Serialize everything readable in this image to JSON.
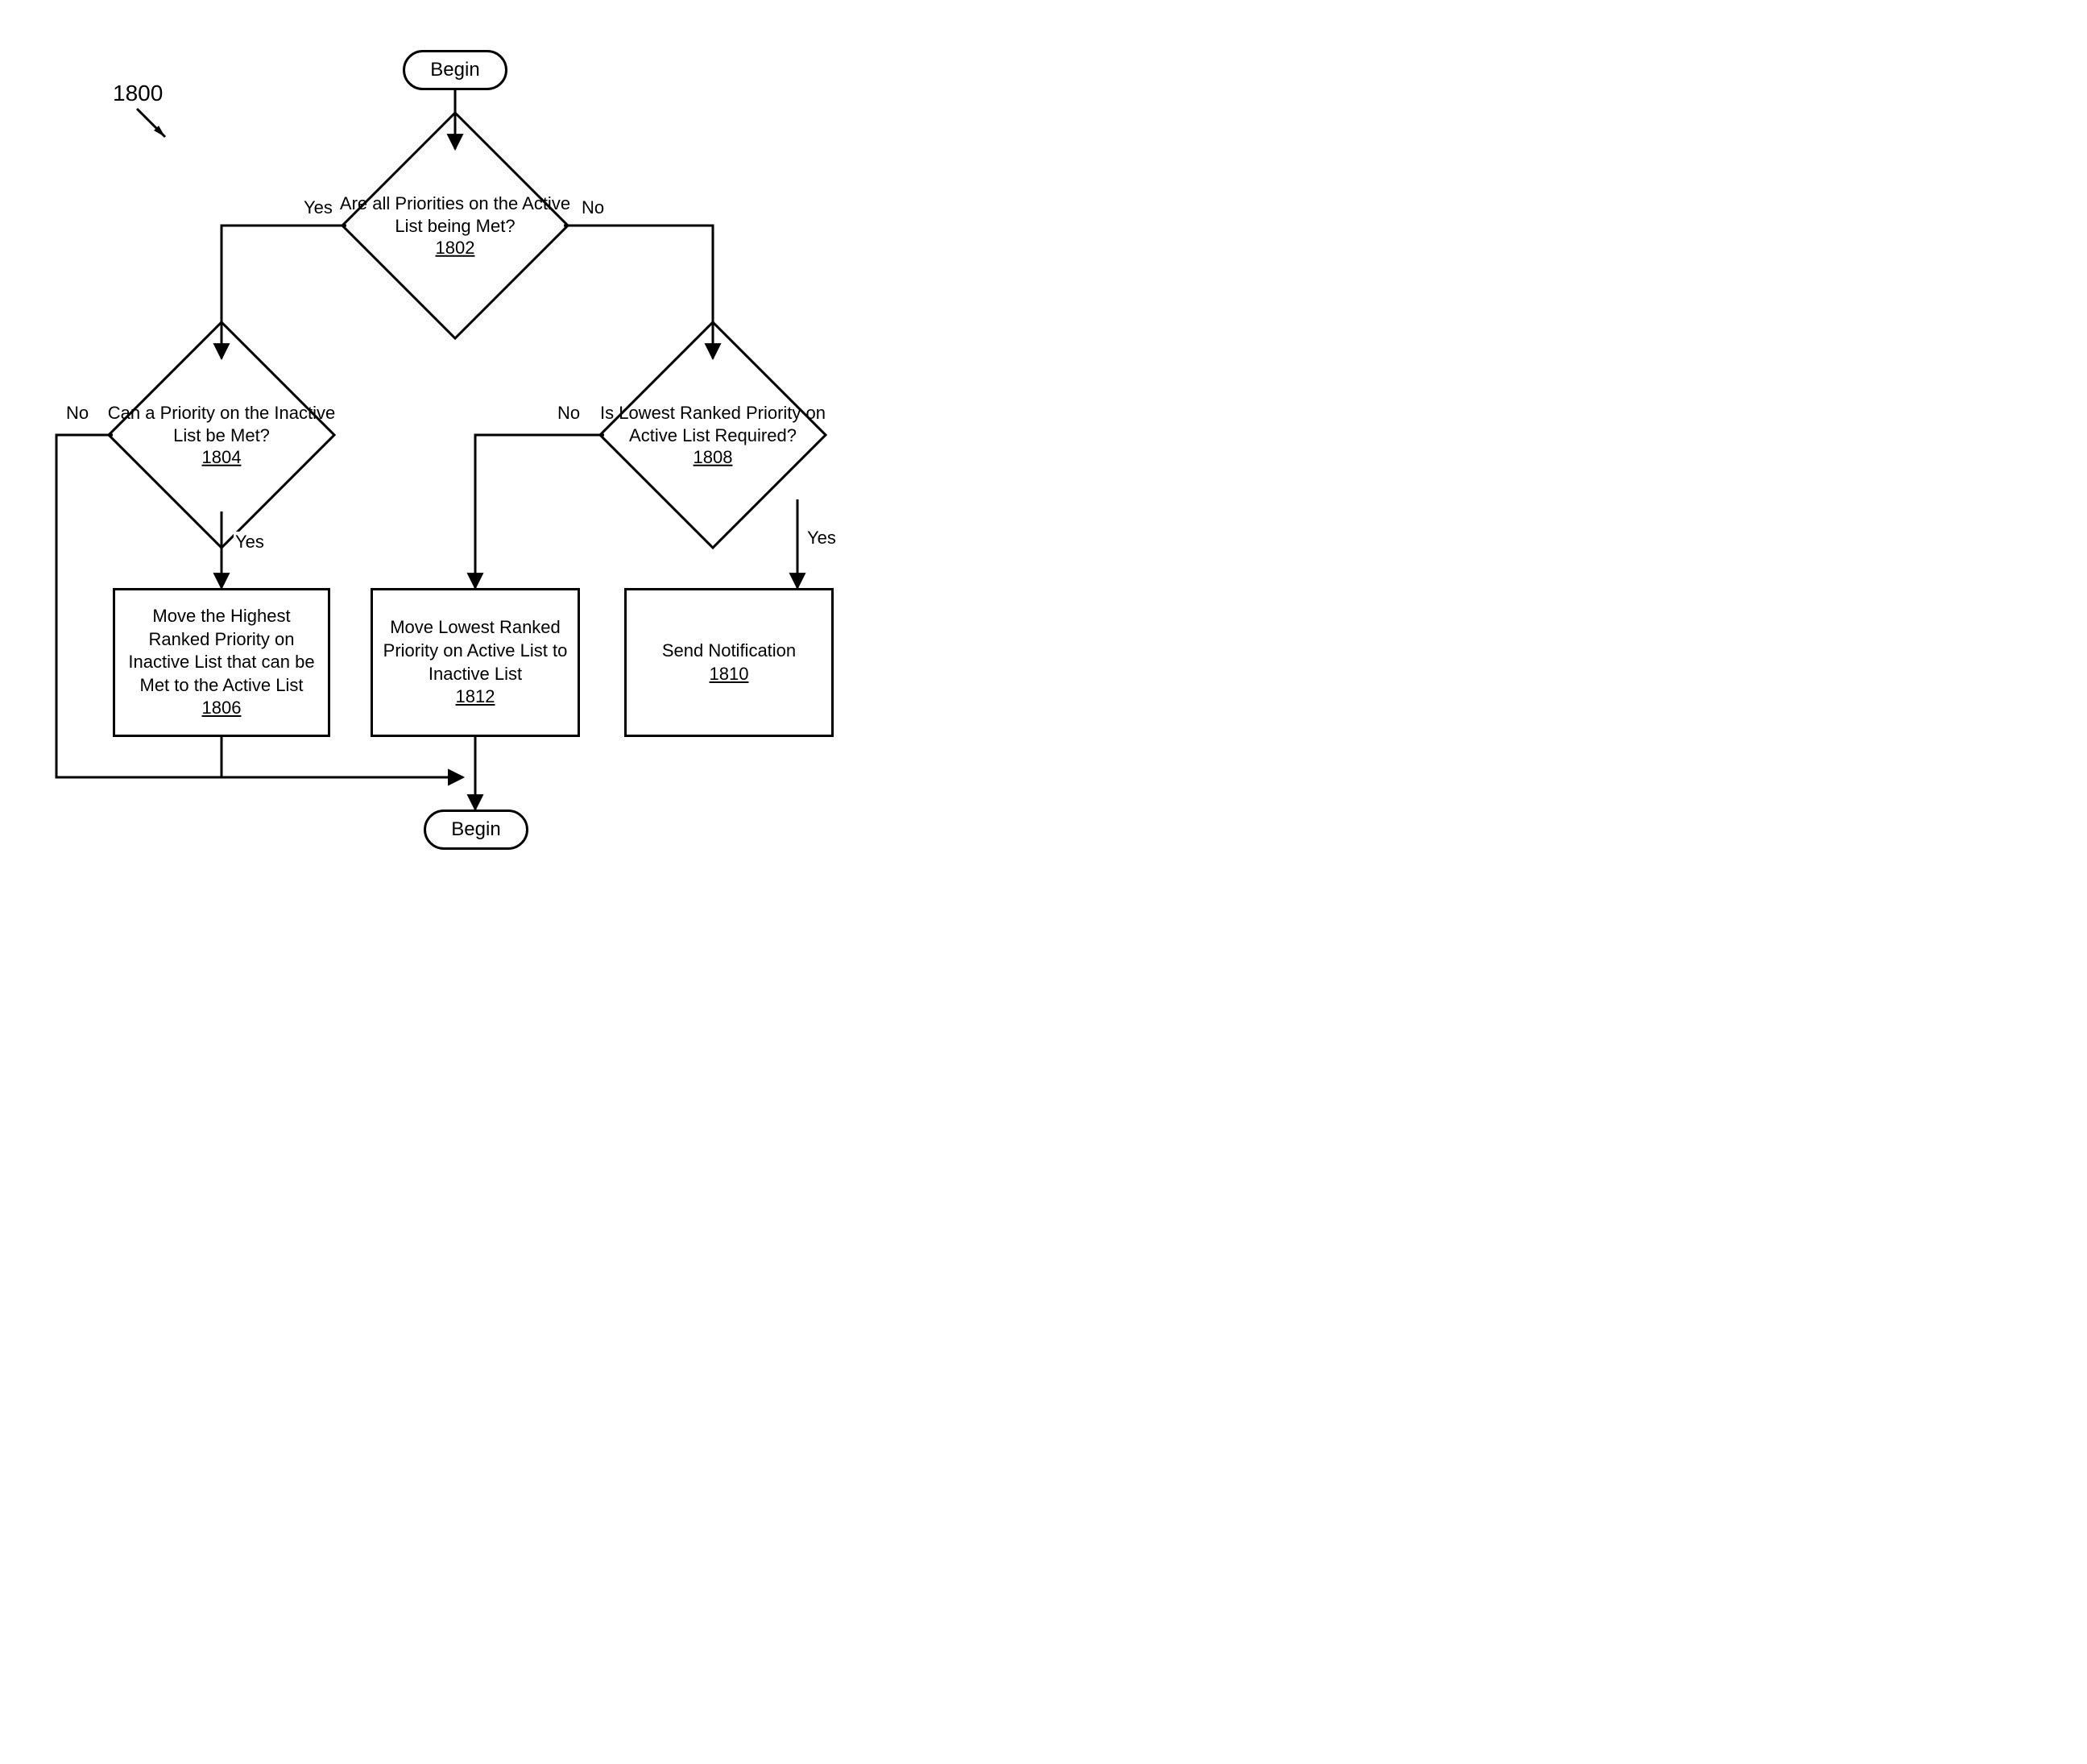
{
  "figure_ref": "1800",
  "terminals": {
    "start": "Begin",
    "end": "Begin"
  },
  "decisions": {
    "d1802": {
      "text": "Are all Priorities on the Active List being Met?",
      "ref": "1802"
    },
    "d1804": {
      "text": "Can a Priority on the Inactive List be Met?",
      "ref": "1804"
    },
    "d1808": {
      "text": "Is Lowest Ranked Priority on Active List Required?",
      "ref": "1808"
    }
  },
  "processes": {
    "p1806": {
      "text": "Move the Highest Ranked Priority on Inactive List that can be Met to the Active List",
      "ref": "1806"
    },
    "p1812": {
      "text": "Move Lowest Ranked Priority on Active List to Inactive List",
      "ref": "1812"
    },
    "p1810": {
      "text": "Send Notification",
      "ref": "1810"
    }
  },
  "edgeLabels": {
    "d1802_yes": "Yes",
    "d1802_no": "No",
    "d1804_yes": "Yes",
    "d1804_no": "No",
    "d1808_yes": "Yes",
    "d1808_no": "No"
  }
}
